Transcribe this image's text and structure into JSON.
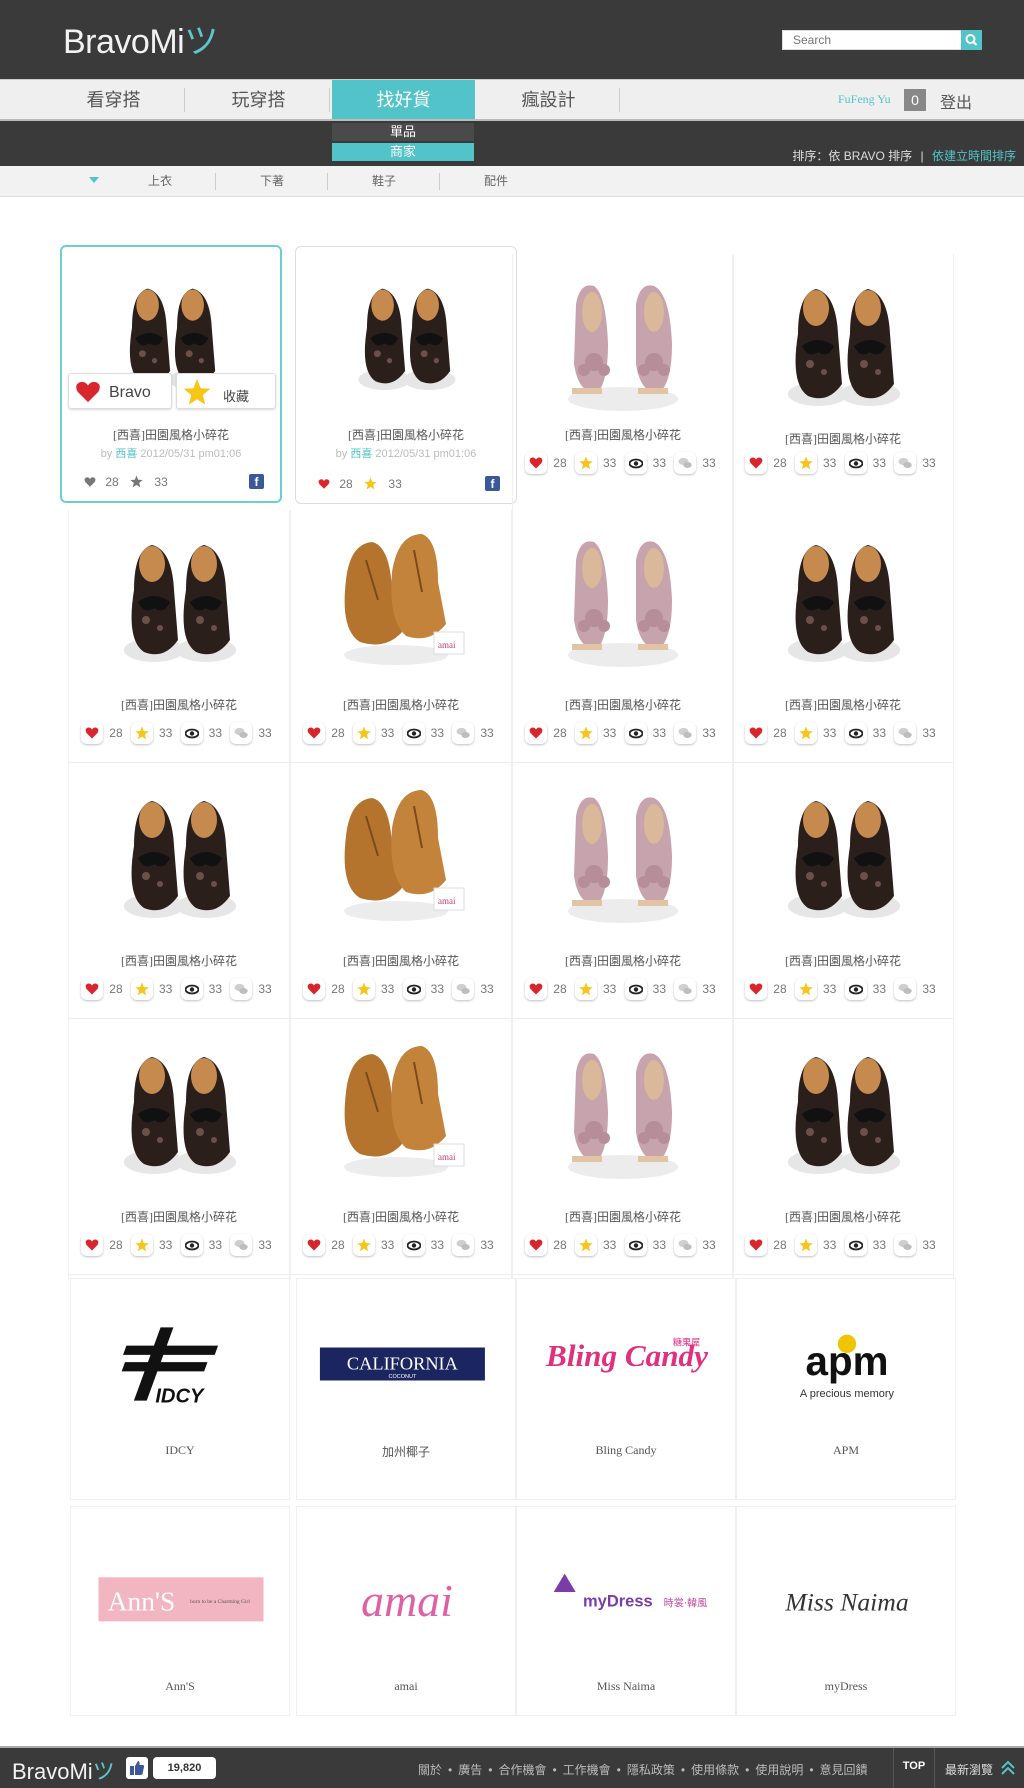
{
  "header": {
    "logo_main": "BravoMi",
    "logo_accent": "ツ",
    "search_placeholder": "Search"
  },
  "nav": {
    "tabs": [
      "看穿搭",
      "玩穿搭",
      "找好貨",
      "瘋設計"
    ],
    "active_tab": "找好貨",
    "user_name": "FuFeng Yu",
    "message_count": "0",
    "logout_label": "登出"
  },
  "submenu": {
    "items": [
      "單品",
      "商家"
    ],
    "active": "商家"
  },
  "sort": {
    "label": "排序：依 BRAVO 排序",
    "separator": "|",
    "alt_link": "依建立時間排序"
  },
  "categories": [
    "上衣",
    "下著",
    "鞋子",
    "配件"
  ],
  "colors": {
    "accent": "#52c3c8",
    "dark_bar": "#3a3a3a",
    "heart": "#d9262c",
    "star": "#f5c518"
  },
  "featured": [
    {
      "title": "[西喜]田園風格小碎花",
      "by_prefix": "by",
      "author": "西喜",
      "datetime": "2012/05/31 pm01:06",
      "likes": "28",
      "favorites": "33",
      "bravo_label": "Bravo",
      "collect_label": "收藏",
      "shoe": "black"
    },
    {
      "title": "[西喜]田園風格小碎花",
      "by_prefix": "by",
      "author": "西喜",
      "datetime": "2012/05/31 pm01:06",
      "likes": "28",
      "favorites": "33",
      "shoe": "black"
    }
  ],
  "products": [
    {
      "title": "[西喜]田園風格小碎花",
      "likes": "28",
      "stars": "33",
      "views": "33",
      "comments": "33",
      "shoe": "pink"
    },
    {
      "title": "[西喜]田園風格小碎花",
      "likes": "28",
      "stars": "33",
      "views": "33",
      "comments": "33",
      "shoe": "black"
    },
    {
      "title": "[西喜]田園風格小碎花",
      "likes": "28",
      "stars": "33",
      "views": "33",
      "comments": "33",
      "shoe": "black"
    },
    {
      "title": "[西喜]田園風格小碎花",
      "likes": "28",
      "stars": "33",
      "views": "33",
      "comments": "33",
      "shoe": "tan"
    },
    {
      "title": "[西喜]田園風格小碎花",
      "likes": "28",
      "stars": "33",
      "views": "33",
      "comments": "33",
      "shoe": "pink"
    },
    {
      "title": "[西喜]田園風格小碎花",
      "likes": "28",
      "stars": "33",
      "views": "33",
      "comments": "33",
      "shoe": "black"
    },
    {
      "title": "[西喜]田園風格小碎花",
      "likes": "28",
      "stars": "33",
      "views": "33",
      "comments": "33",
      "shoe": "black"
    },
    {
      "title": "[西喜]田園風格小碎花",
      "likes": "28",
      "stars": "33",
      "views": "33",
      "comments": "33",
      "shoe": "tan"
    },
    {
      "title": "[西喜]田園風格小碎花",
      "likes": "28",
      "stars": "33",
      "views": "33",
      "comments": "33",
      "shoe": "pink"
    },
    {
      "title": "[西喜]田園風格小碎花",
      "likes": "28",
      "stars": "33",
      "views": "33",
      "comments": "33",
      "shoe": "black"
    },
    {
      "title": "[西喜]田園風格小碎花",
      "likes": "28",
      "stars": "33",
      "views": "33",
      "comments": "33",
      "shoe": "black"
    },
    {
      "title": "[西喜]田園風格小碎花",
      "likes": "28",
      "stars": "33",
      "views": "33",
      "comments": "33",
      "shoe": "tan"
    },
    {
      "title": "[西喜]田園風格小碎花",
      "likes": "28",
      "stars": "33",
      "views": "33",
      "comments": "33",
      "shoe": "pink"
    },
    {
      "title": "[西喜]田園風格小碎花",
      "likes": "28",
      "stars": "33",
      "views": "33",
      "comments": "33",
      "shoe": "black"
    }
  ],
  "brands": [
    {
      "name": "IDCY",
      "logo_text": "IDCY"
    },
    {
      "name": "加州椰子",
      "logo_text": "CALIFORNIA",
      "logo_sub": "COCONUT"
    },
    {
      "name": "Bling Candy",
      "logo_text": "Bling Candy",
      "logo_sub": "糖果屋"
    },
    {
      "name": "APM",
      "logo_text": "apm",
      "logo_sub": "A precious memory"
    },
    {
      "name": "Ann'S",
      "logo_text": "Ann'S",
      "logo_sub": "born to be a Charming Girl"
    },
    {
      "name": "amai",
      "logo_text": "amai"
    },
    {
      "name": "Miss Naima",
      "logo_text": "myDress",
      "logo_sub": "時裳·韓風"
    },
    {
      "name": "myDress",
      "logo_text": "Miss Naima"
    }
  ],
  "footer": {
    "logo_main": "BravoMi",
    "logo_accent": "ツ",
    "like_count": "19,820",
    "links": [
      "關於",
      "廣告",
      "合作機會",
      "工作機會",
      "隱私政策",
      "使用條款",
      "使用說明",
      "意見回饋"
    ],
    "link_separator": "•",
    "top_label": "TOP",
    "newest_label": "最新瀏覽"
  }
}
